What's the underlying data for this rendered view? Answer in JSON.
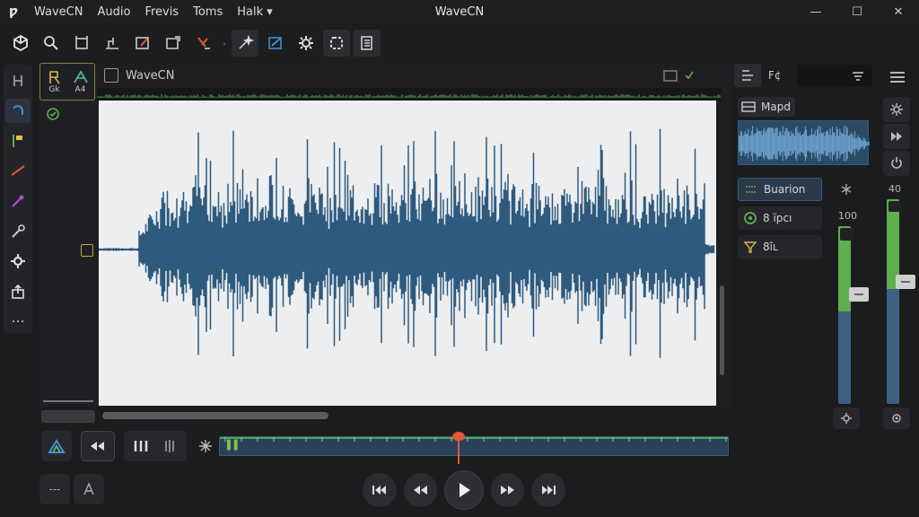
{
  "app": {
    "logo": "ƿ",
    "window_title": "WaveCN",
    "menu": [
      "WaveCN",
      "Audio",
      "Frevis",
      "Toms",
      "Halk ▾"
    ]
  },
  "window_controls": {
    "minimize": "—",
    "maximize": "☐",
    "close": "✕"
  },
  "toolbar": {
    "icons": [
      "cube-icon",
      "zoom-icon",
      "crop-icon",
      "trim-icon",
      "draw-icon",
      "frame-icon",
      "cut-icon",
      "chevron-right-icon",
      "magic-icon",
      "link-icon",
      "gear-icon",
      "select-icon",
      "clip-icon"
    ]
  },
  "track": {
    "btn1_label": "Gk",
    "btn2_label": "A4"
  },
  "editor": {
    "title": "WaveCN"
  },
  "right_panel": {
    "tab_label": "F¢",
    "mapd_label": "Mapd",
    "options": [
      "Buarion",
      "8 ïpcı",
      "8ĩʟ"
    ],
    "level_label": "100",
    "far_level_label": "40"
  },
  "row2": {
    "dots_label": "---"
  },
  "colors": {
    "wave": "#2e5a7e",
    "accent_green": "#5fae4e",
    "playhead": "#e2563b"
  }
}
